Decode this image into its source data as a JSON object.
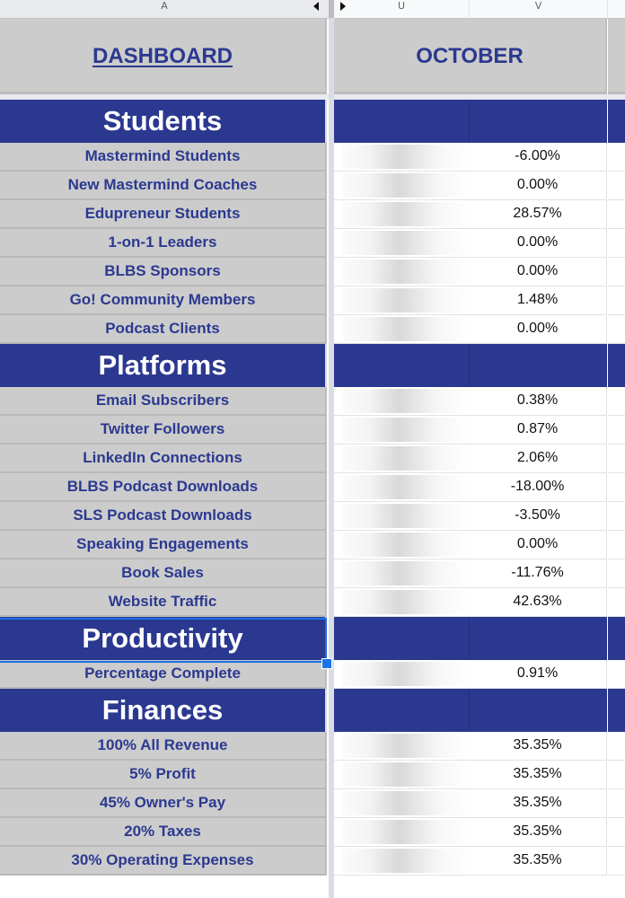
{
  "columns": {
    "a": "A",
    "u": "U",
    "v": "V"
  },
  "title_row": {
    "dashboard": "DASHBOARD",
    "month": "OCTOBER"
  },
  "colors": {
    "brand_blue": "#2b3890",
    "positive": "#92c47c",
    "negative": "#e06666",
    "label_grey": "#cccccc"
  },
  "sections": [
    {
      "title": "Students",
      "rows": [
        {
          "label": "Mastermind Students",
          "change": "-6.00%",
          "status": "negative"
        },
        {
          "label": "New Mastermind Coaches",
          "change": "0.00%",
          "status": "zero"
        },
        {
          "label": "Edupreneur Students",
          "change": "28.57%",
          "status": "positive"
        },
        {
          "label": "1-on-1 Leaders",
          "change": "0.00%",
          "status": "zero"
        },
        {
          "label": "BLBS Sponsors",
          "change": "0.00%",
          "status": "zero"
        },
        {
          "label": "Go! Community Members",
          "change": "1.48%",
          "status": "positive"
        },
        {
          "label": "Podcast Clients",
          "change": "0.00%",
          "status": "zero"
        }
      ]
    },
    {
      "title": "Platforms",
      "rows": [
        {
          "label": "Email Subscribers",
          "change": "0.38%",
          "status": "positive"
        },
        {
          "label": "Twitter Followers",
          "change": "0.87%",
          "status": "positive"
        },
        {
          "label": "LinkedIn Connections",
          "change": "2.06%",
          "status": "positive"
        },
        {
          "label": "BLBS Podcast Downloads",
          "change": "-18.00%",
          "status": "negative"
        },
        {
          "label": "SLS Podcast Downloads",
          "change": "-3.50%",
          "status": "negative"
        },
        {
          "label": "Speaking Engagements",
          "change": "0.00%",
          "status": "zero"
        },
        {
          "label": "Book Sales",
          "change": "-11.76%",
          "status": "negative"
        },
        {
          "label": "Website Traffic",
          "change": "42.63%",
          "status": "positive"
        }
      ]
    },
    {
      "title": "Productivity",
      "rows": [
        {
          "label": "Percentage Complete",
          "change": "0.91%",
          "status": "positive"
        }
      ]
    },
    {
      "title": "Finances",
      "rows": [
        {
          "label": "100% All Revenue",
          "change": "35.35%",
          "status": "positive"
        },
        {
          "label": "5% Profit",
          "change": "35.35%",
          "status": "positive"
        },
        {
          "label": "45% Owner's Pay",
          "change": "35.35%",
          "status": "positive"
        },
        {
          "label": "20% Taxes",
          "change": "35.35%",
          "status": "positive"
        },
        {
          "label": "30% Operating Expenses",
          "change": "35.35%",
          "status": "positive"
        }
      ]
    }
  ]
}
